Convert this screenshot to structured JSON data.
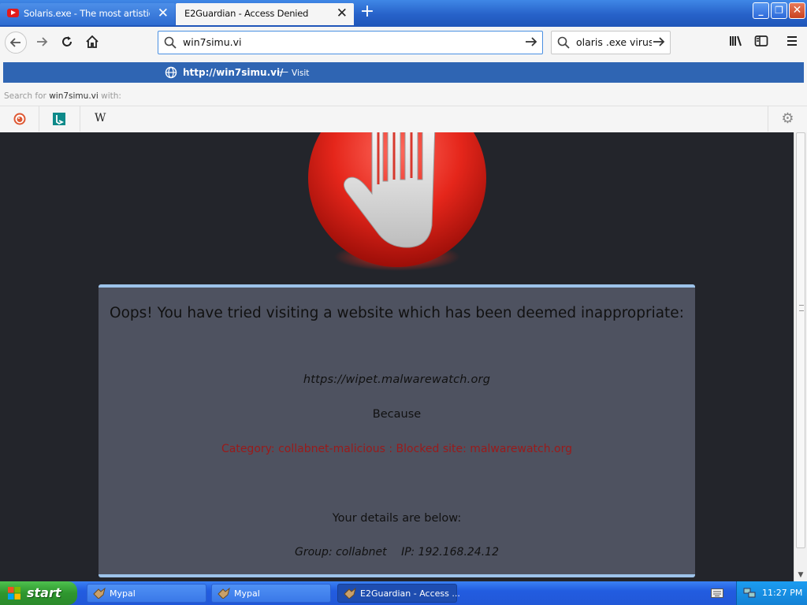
{
  "browser": {
    "tabs": [
      {
        "label": "Solaris.exe - The most artistic com",
        "active": false
      },
      {
        "label": "E2Guardian - Access Denied",
        "active": true
      }
    ],
    "new_tab_symbol": "+",
    "close_symbol": "✕",
    "address": {
      "value": "win7simu.vi"
    },
    "search": {
      "value": "olaris .exe virus"
    },
    "toolbar_icons": [
      "back-icon",
      "forward-icon",
      "reload-icon",
      "home-icon",
      "library-icon",
      "sidebar-icon",
      "menu-icon"
    ]
  },
  "dropdown": {
    "suggestion_url": "http://win7simu.vi/",
    "suggestion_separator": "—",
    "suggestion_action": "Visit",
    "search_for_prefix": "Search for",
    "search_for_term": "win7simu.vi",
    "search_for_suffix": "with:",
    "engines": [
      "duckduckgo-icon",
      "bing-icon",
      "wikipedia-icon"
    ],
    "wikipedia_glyph": "W"
  },
  "page": {
    "headline": "Oops! You have tried visiting a website which has been deemed inappropriate:",
    "blocked_url": "https://wipet.malwarewatch.org",
    "because_label": "Because",
    "reason": "Category: collabnet-malicious : Blocked site: malwarewatch.org",
    "details_heading": "Your details are below:",
    "group": "Group: collabnet",
    "ip": "IP: 192.168.24.12"
  },
  "taskbar": {
    "start_label": "start",
    "tasks": [
      {
        "label": "Mypal",
        "active": false
      },
      {
        "label": "Mypal",
        "active": false
      },
      {
        "label": "E2Guardian - Access ...",
        "active": true
      }
    ],
    "clock": "11:27 PM"
  },
  "colors": {
    "page_bg": "#23252b",
    "card_bg": "#4e5260",
    "card_border": "#9dc3ea",
    "reason_text": "#9a1a1a",
    "suggestion_bg": "#2f65b3"
  }
}
